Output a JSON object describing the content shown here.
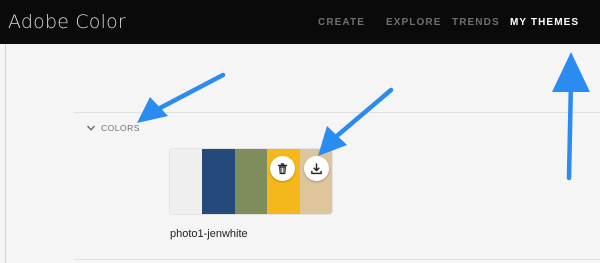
{
  "app": {
    "title": "Adobe Color"
  },
  "nav": {
    "items": [
      {
        "label": "CREATE",
        "active": false
      },
      {
        "label": "EXPLORE",
        "active": false
      },
      {
        "label": "TRENDS",
        "active": false
      },
      {
        "label": "MY THEMES",
        "active": true
      }
    ]
  },
  "section": {
    "label": "COLORS",
    "toggle_icon": "chevron-down-icon"
  },
  "theme": {
    "name": "photo1-jenwhite",
    "swatches": [
      "#efeff0",
      "#24497a",
      "#7f8c5c",
      "#f4b81c",
      "#dfc59c"
    ],
    "actions": [
      {
        "icon": "trash-icon"
      },
      {
        "icon": "download-icon"
      }
    ]
  },
  "annotation": {
    "arrow_color": "#2a8cf0"
  }
}
